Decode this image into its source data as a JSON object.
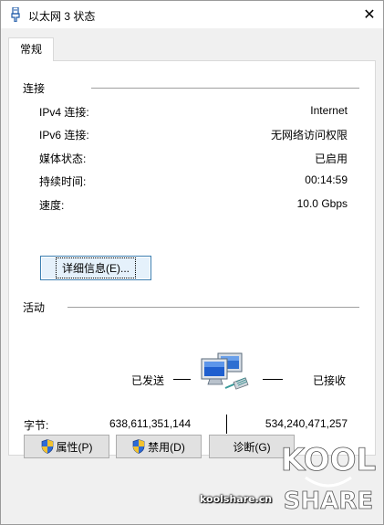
{
  "window": {
    "title": "以太网 3 状态",
    "close_glyph": "✕"
  },
  "tabs": [
    {
      "label": "常规",
      "selected": true
    }
  ],
  "connection": {
    "group_label": "连接",
    "rows": [
      {
        "label": "IPv4 连接:",
        "value": "Internet"
      },
      {
        "label": "IPv6 连接:",
        "value": "无网络访问权限"
      },
      {
        "label": "媒体状态:",
        "value": "已启用"
      },
      {
        "label": "持续时间:",
        "value": "00:14:59"
      },
      {
        "label": "速度:",
        "value": "10.0 Gbps"
      }
    ],
    "details_button": "详细信息(E)..."
  },
  "activity": {
    "group_label": "活动",
    "sent_label": "已发送",
    "received_label": "已接收",
    "bytes_label": "字节:",
    "bytes_sent": "638,611,351,144",
    "bytes_received": "534,240,471,257"
  },
  "buttons": {
    "properties": "属性(P)",
    "disable": "禁用(D)",
    "diagnose": "诊断(G)"
  },
  "watermark": {
    "site": "koolshare.cn",
    "logo_top": "KOOL",
    "logo_bottom": "SHARE"
  },
  "colors": {
    "accent_button_border": "#3c7fb1",
    "accent_button_fill": "#e5f1fb",
    "panel_border": "#d9d9d9",
    "client_bg": "#f0f0f0"
  }
}
